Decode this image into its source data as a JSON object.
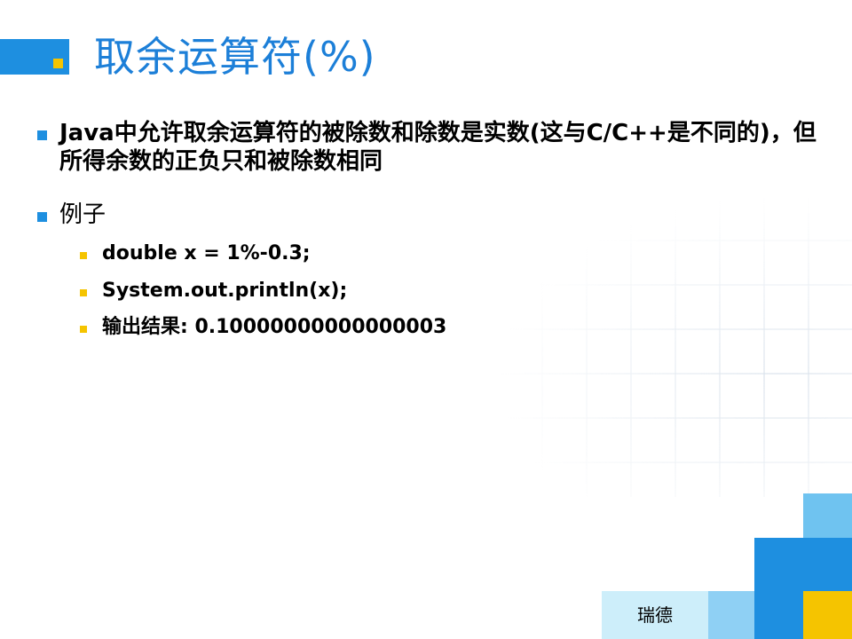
{
  "slide": {
    "title": "取余运算符(%)",
    "bullets": [
      {
        "text": "Java中允许取余运算符的被除数和除数是实数(这与C/C++是不同的)，但所得余数的正负只和被除数相同"
      },
      {
        "text": "例子"
      }
    ],
    "sub_bullets": [
      {
        "text": "double x = 1%-0.3;"
      },
      {
        "text": "System.out.println(x);"
      },
      {
        "text": "输出结果: 0.10000000000000003"
      }
    ],
    "footer": "瑞德"
  },
  "colors": {
    "accent_blue": "#1e8fe0",
    "title_blue": "#1c7fd8",
    "accent_yellow": "#f5c400",
    "light_blue": "#6fc3f0",
    "pale_blue": "#cdeefa"
  }
}
